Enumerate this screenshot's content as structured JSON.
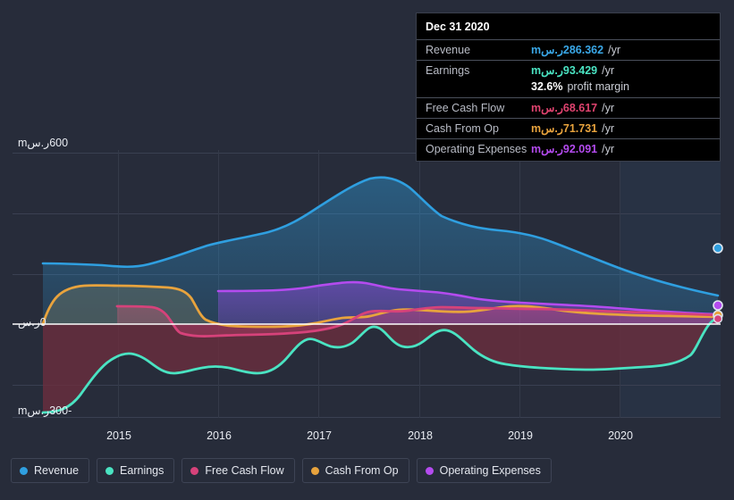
{
  "theme": {
    "background": "#272c3a",
    "gridline": "#343a49",
    "zero_line": "#ffffff",
    "axis_text": "#e9ecf2",
    "tooltip_bg": "#000000",
    "tooltip_border": "#3a3f4c"
  },
  "tooltip": {
    "title": "Dec 31 2020",
    "rows": [
      {
        "label": "Revenue",
        "value": "286.362ر.سm",
        "suffix": "/yr",
        "color": "#3aa8e8"
      },
      {
        "label": "Earnings",
        "value": "93.429ر.سm",
        "suffix": "/yr",
        "color": "#4ae3c2"
      },
      {
        "label": "",
        "value": "32.6%",
        "suffix": "profit margin",
        "color": "#ffffff"
      },
      {
        "label": "Free Cash Flow",
        "value": "68.617ر.سm",
        "suffix": "/yr",
        "color": "#e0436f"
      },
      {
        "label": "Cash From Op",
        "value": "71.731ر.سm",
        "suffix": "/yr",
        "color": "#e8a33d"
      },
      {
        "label": "Operating Expenses",
        "value": "92.091ر.سm",
        "suffix": "/yr",
        "color": "#b44bef"
      }
    ]
  },
  "legend": {
    "items": [
      {
        "label": "Revenue",
        "color": "#2f9fe0"
      },
      {
        "label": "Earnings",
        "color": "#4ae3c2"
      },
      {
        "label": "Free Cash Flow",
        "color": "#d6427a"
      },
      {
        "label": "Cash From Op",
        "color": "#e8a33d"
      },
      {
        "label": "Operating Expenses",
        "color": "#b44bef"
      }
    ]
  },
  "axes": {
    "y_labels": [
      {
        "text": "600ر.سm",
        "value": 600
      },
      {
        "text": "0ر.س",
        "value": 0
      },
      {
        "text": "-300ر.سm",
        "value": -300
      }
    ],
    "x_labels": [
      "2015",
      "2016",
      "2017",
      "2018",
      "2019",
      "2020"
    ]
  },
  "chart_data": {
    "type": "area",
    "title": "",
    "subtitle": "",
    "xlabel": "",
    "ylabel": "ر.سm",
    "ylim": [
      -300,
      600
    ],
    "xlim": [
      "2014.4",
      "2021.0"
    ],
    "grid": true,
    "legend_position": "bottom-left",
    "currency": "ر.س",
    "unit": "m",
    "period": "/yr",
    "x_tick_labels": [
      "2015",
      "2016",
      "2017",
      "2018",
      "2019",
      "2020"
    ],
    "y_tick_labels": [
      "600ر.سm",
      "0ر.س",
      "-300ر.سm"
    ],
    "highlight_date": "Dec 31 2020",
    "series": [
      {
        "name": "Revenue",
        "color": "#2f9fe0",
        "fill": true,
        "x": [
          2014.4,
          2014.8,
          2015.0,
          2015.3,
          2015.6,
          2016.0,
          2016.4,
          2016.8,
          2017.0,
          2017.3,
          2017.6,
          2017.8,
          2018.0,
          2018.3,
          2018.6,
          2019.0,
          2019.4,
          2019.8,
          2020.2,
          2020.6,
          2021.0
        ],
        "y": [
          228,
          226,
          222,
          236,
          258,
          278,
          288,
          292,
          300,
          330,
          372,
          395,
          392,
          372,
          350,
          345,
          330,
          312,
          300,
          292,
          286.362
        ],
        "last_value": 286.362
      },
      {
        "name": "Earnings",
        "color": "#4ae3c2",
        "fill": true,
        "x": [
          2014.4,
          2014.6,
          2014.9,
          2015.0,
          2015.2,
          2015.4,
          2015.6,
          2015.9,
          2016.1,
          2016.4,
          2016.7,
          2017.0,
          2017.2,
          2017.4,
          2017.6,
          2017.9,
          2018.2,
          2018.5,
          2018.8,
          2019.1,
          2019.5,
          2019.9,
          2020.3,
          2020.7,
          2021.0
        ],
        "y": [
          -300,
          -190,
          -160,
          -155,
          -130,
          -148,
          -150,
          -170,
          -160,
          -160,
          -125,
          -52,
          -24,
          -48,
          -30,
          -60,
          -58,
          -52,
          -30,
          -95,
          -88,
          -85,
          -72,
          -55,
          93.429
        ],
        "last_value": 93.429
      },
      {
        "name": "Free Cash Flow",
        "color": "#d6427a",
        "fill": true,
        "x": [
          2015.0,
          2015.25,
          2015.5,
          2015.7,
          2015.85,
          2016.0,
          2016.3,
          2016.7,
          2017.0,
          2017.3,
          2017.6,
          2017.9,
          2018.2,
          2018.5,
          2018.8,
          2019.2,
          2019.6,
          2020.0,
          2020.4,
          2020.8,
          2021.0
        ],
        "y": [
          162,
          160,
          158,
          120,
          20,
          -22,
          -32,
          -28,
          -22,
          -20,
          -15,
          32,
          38,
          60,
          58,
          56,
          55,
          56,
          58,
          62,
          68.617
        ],
        "last_value": 68.617
      },
      {
        "name": "Cash From Op",
        "color": "#e8a33d",
        "fill": false,
        "x": [
          2014.4,
          2014.55,
          2014.75,
          2015.0,
          2015.3,
          2015.6,
          2015.75,
          2015.9,
          2016.1,
          2016.4,
          2016.8,
          2017.1,
          2017.4,
          2017.7,
          2018.0,
          2018.3,
          2018.6,
          2018.9,
          2019.2,
          2019.6,
          2020.0,
          2020.4,
          2020.8,
          2021.0
        ],
        "y": [
          0,
          100,
          155,
          172,
          172,
          168,
          130,
          30,
          -4,
          -5,
          -4,
          8,
          5,
          12,
          48,
          38,
          42,
          40,
          62,
          70,
          72,
          72,
          70,
          71.731
        ],
        "last_value": 71.731
      },
      {
        "name": "Operating Expenses",
        "color": "#b44bef",
        "fill": true,
        "x": [
          2016.0,
          2016.4,
          2016.8,
          2017.1,
          2017.4,
          2017.7,
          2018.0,
          2018.3,
          2018.6,
          2018.9,
          2019.2,
          2019.6,
          2020.0,
          2020.4,
          2020.8,
          2021.0
        ],
        "y": [
          172,
          170,
          172,
          180,
          190,
          200,
          200,
          190,
          170,
          162,
          152,
          145,
          140,
          130,
          120,
          92.091
        ],
        "last_value": 92.091
      }
    ]
  }
}
